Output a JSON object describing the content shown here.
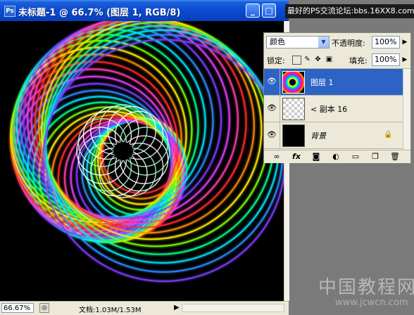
{
  "document": {
    "title": "未标题-1 @ 66.7% (图层 1, RGB/8)",
    "title_icon": "Ps",
    "minimize_glyph": "_",
    "maximize_glyph": "□",
    "zoom": "66.67%",
    "doc_info": "文档:1.03M/1.53M",
    "status_arrow": "▶"
  },
  "forum_watermark": "最好的PS交流论坛:bbs.16XX8.com",
  "layers_panel": {
    "blend_mode": "颜色",
    "opacity_label": "不透明度:",
    "opacity_value": "100%",
    "lock_label": "锁定:",
    "fill_label": "填充:",
    "fill_value": "100%",
    "layers": [
      {
        "name": "图层 1",
        "selected": true
      },
      {
        "name": "< 副本 16",
        "selected": false
      },
      {
        "name": "背景",
        "selected": false,
        "locked": true
      }
    ],
    "footer_icons": [
      "link-icon",
      "fx-icon",
      "mask-icon",
      "adjustment-icon",
      "group-icon",
      "new-layer-icon",
      "trash-icon"
    ]
  },
  "site_watermark": {
    "name": "中国教程网",
    "url": "www.jcwcn.com"
  },
  "colors": {
    "titlebar": "#0a4ad1",
    "selected_layer": "#2d63c5",
    "canvas_bg": "#000000",
    "panel_bg": "#ece9d8"
  }
}
